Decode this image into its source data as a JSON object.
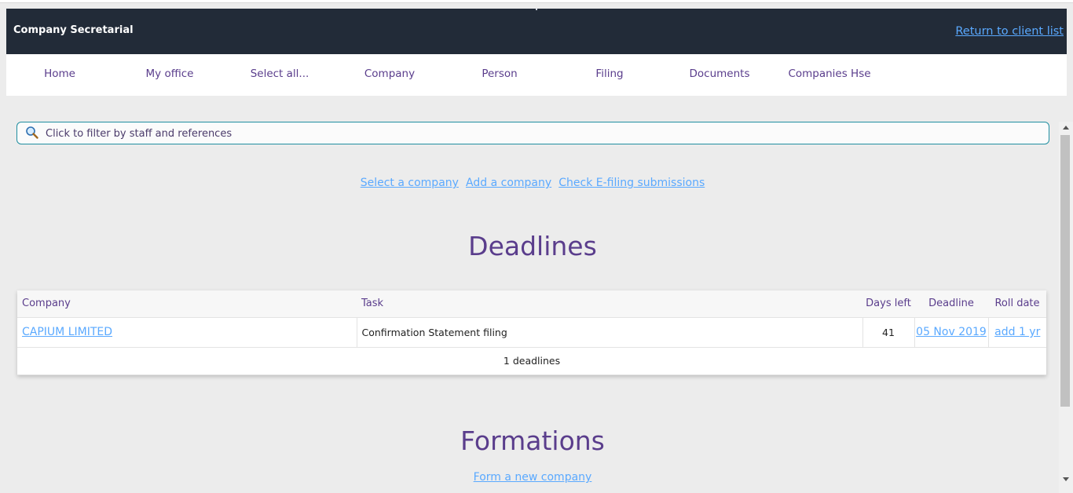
{
  "header": {
    "title": "Company Secretarial",
    "return_link": "Return to client list"
  },
  "nav": {
    "items": [
      "Home",
      "My office",
      "Select all...",
      "Company",
      "Person",
      "Filing",
      "Documents",
      "Companies Hse"
    ]
  },
  "filter": {
    "placeholder": "Click to filter by staff and references"
  },
  "actions": {
    "select_company": "Select a company",
    "add_company": "Add a company",
    "check_efiling": "Check E-filing submissions"
  },
  "deadlines": {
    "title": "Deadlines",
    "columns": [
      "Company",
      "Task",
      "Days left",
      "Deadline",
      "Roll date"
    ],
    "rows": [
      {
        "company": "CAPIUM LIMITED",
        "task": "Confirmation Statement filing",
        "days_left": "41",
        "deadline": "05 Nov 2019",
        "roll_date": "add 1 yr"
      }
    ],
    "total": "1 deadlines"
  },
  "formations": {
    "title": "Formations",
    "link": "Form a new company"
  },
  "colors": {
    "header_bg": "#222b38",
    "accent_purple": "#5a3d8c",
    "link_blue": "#5aa9ff",
    "filter_border": "#1f8ea0"
  }
}
